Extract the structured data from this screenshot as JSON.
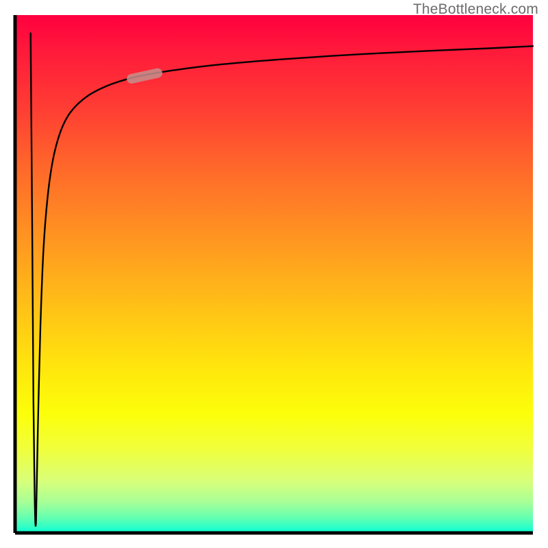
{
  "watermark": "TheBottleneck.com",
  "chart_data": {
    "type": "line",
    "title": "",
    "xlabel": "",
    "ylabel": "",
    "xlim": [
      0,
      100
    ],
    "ylim": [
      0,
      100
    ],
    "grid": false,
    "legend": false,
    "gradient_background": {
      "top_color": "#ff0040",
      "middle_color": "#ffe000",
      "bottom_color": "#00ffcc"
    },
    "series": [
      {
        "name": "bottleneck-curve",
        "color": "#000000",
        "x": [
          2.8,
          3.2,
          3.6,
          4.0,
          4.6,
          5.8,
          7.0,
          8.4,
          10.0,
          12.0,
          15.0,
          20.0,
          26.0,
          34.0,
          45.0,
          60.0,
          78.0,
          92.0,
          100.0
        ],
        "y": [
          97.5,
          70.0,
          50.0,
          40.0,
          30.0,
          22.0,
          18.0,
          15.0,
          13.0,
          11.4,
          10.0,
          8.6,
          7.6,
          6.8,
          6.1,
          5.5,
          5.1,
          4.9,
          4.8
        ]
      },
      {
        "name": "highlight-segment",
        "color": "#c58f8c",
        "x": [
          21.0,
          27.0
        ],
        "y": [
          13.5,
          12.2
        ]
      }
    ],
    "annotations": []
  }
}
